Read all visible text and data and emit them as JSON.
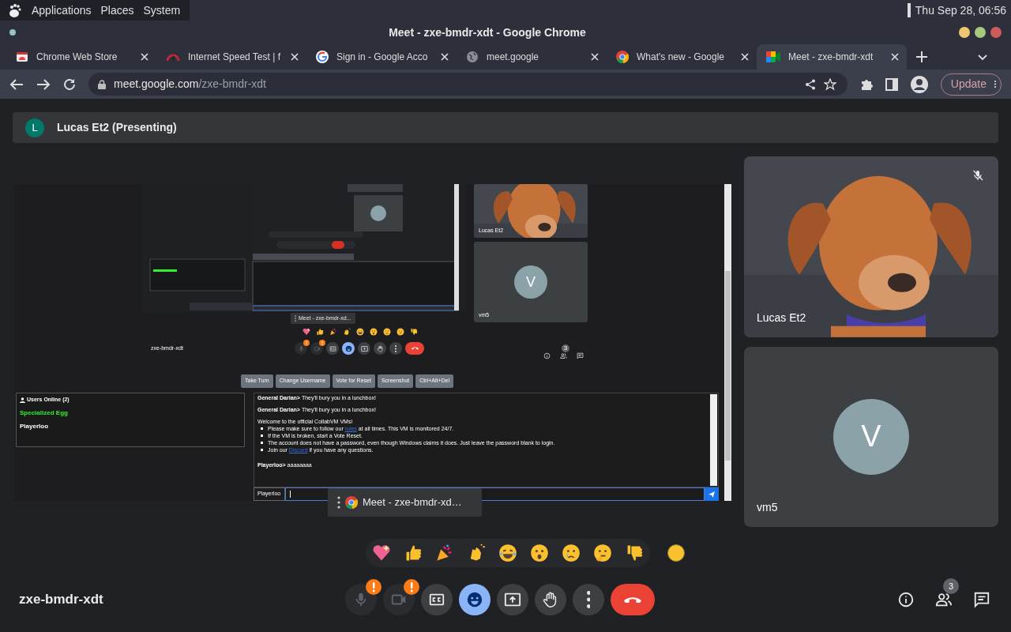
{
  "desktop": {
    "menus": [
      "Applications",
      "Places",
      "System"
    ],
    "clock": "Thu Sep 28, 06:56"
  },
  "window": {
    "title": "Meet - zxe-bmdr-xdt - Google Chrome"
  },
  "tabs": [
    {
      "label": "Chrome Web Store",
      "kind": "store",
      "selected": false
    },
    {
      "label": "Internet Speed Test | f",
      "kind": "speed",
      "selected": false
    },
    {
      "label": "Sign in - Google Acco",
      "kind": "google",
      "selected": false
    },
    {
      "label": "meet.google",
      "kind": "globe",
      "selected": false
    },
    {
      "label": "What's new - Google",
      "kind": "chrome",
      "selected": false
    },
    {
      "label": "Meet - zxe-bmdr-xdt",
      "kind": "meet",
      "selected": true
    }
  ],
  "address": {
    "host": "meet.google.com",
    "path": "/zxe-bmdr-xdt"
  },
  "update_button": "Update",
  "presenter": {
    "initial": "L",
    "label": "Lucas Et2 (Presenting)"
  },
  "shared_screen": {
    "tiles": [
      {
        "kind": "picture",
        "name": "Lucas Et2"
      },
      {
        "kind": "avatar",
        "initial": "V",
        "name": "vm5"
      }
    ],
    "meeting_code": "zxe-bmdr-xdt",
    "people_count": "3",
    "sharing_popup": "Meet - zxe-bmdr-xd...",
    "toolbar": [
      "Take Turn",
      "Change Username",
      "Vote for Reset",
      "Screenshot",
      "Ctrl+Alt+Del"
    ],
    "users_title": "Users Online (2)",
    "users": [
      {
        "name": "Specialized Egg",
        "color": "#33ee33"
      },
      {
        "name": "Playerloo",
        "color": "#ffffff"
      }
    ],
    "chat": [
      {
        "user": "General Darian>",
        "text": "They'll bury you in a lunchbox!"
      },
      {
        "user": "General Darian>",
        "text": "They'll bury you in a lunchbox!"
      }
    ],
    "welcome": {
      "title": "Welcome to the official CollabVM VMs!",
      "items": [
        {
          "before": "Please make sure to follow our",
          "link": "rules",
          "after": "at all times. This VM is monitored 24/7."
        },
        {
          "before": "If the VM is broken, start a Vote Reset."
        },
        {
          "before": "The account does not have a password, even though Windows claims it does. Just leave the password blank to login."
        },
        {
          "before": "Join our",
          "link": "Discord",
          "after": "if you have any questions."
        }
      ]
    },
    "last_message": {
      "user": "Playerloo>",
      "text": "aaaaaaaa"
    },
    "chat_username": "Playerloo"
  },
  "sharing_popup": "Meet - zxe-bmdr-xd…",
  "participants": [
    {
      "kind": "picture",
      "name": "Lucas Et2",
      "muted": true
    },
    {
      "kind": "avatar",
      "initial": "V",
      "name": "vm5",
      "muted": false
    }
  ],
  "meeting_code": "zxe-bmdr-xdt",
  "controls": [
    {
      "kind": "mic",
      "warning": true
    },
    {
      "kind": "camera",
      "warning": true
    },
    {
      "kind": "captions",
      "on": false
    },
    {
      "kind": "reactions",
      "on": true
    },
    {
      "kind": "present",
      "on": false
    },
    {
      "kind": "hand",
      "on": false
    },
    {
      "kind": "more"
    },
    {
      "kind": "leave"
    }
  ],
  "people_count": "3"
}
